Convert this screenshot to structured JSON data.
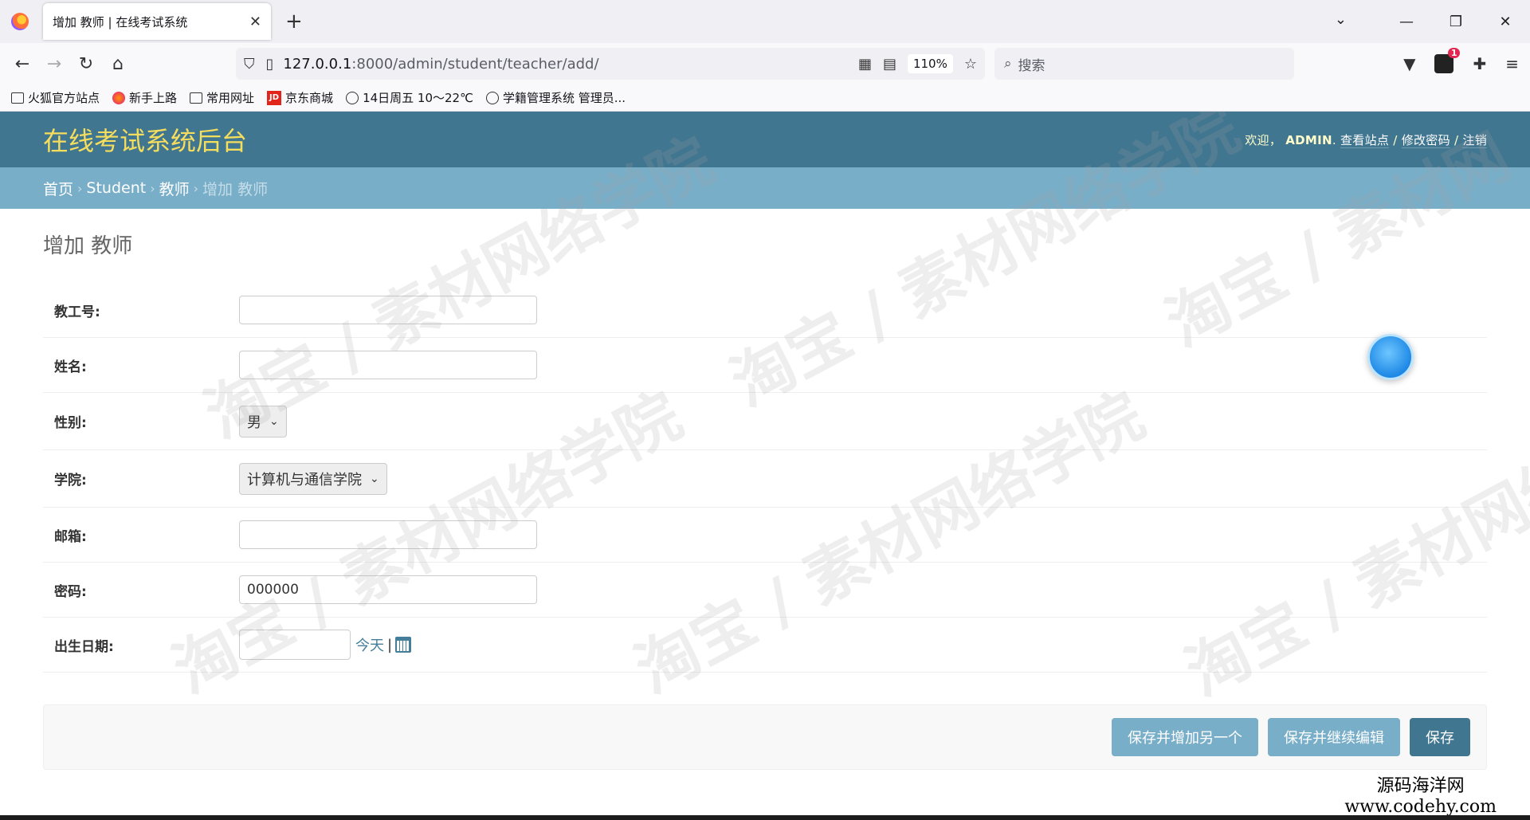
{
  "browser": {
    "tab_title": "增加 教师 | 在线考试系统",
    "url_host": "127.0.0.1",
    "url_path": ":8000/admin/student/teacher/add/",
    "zoom": "110%",
    "search_placeholder": "搜索",
    "extension_badge": "1",
    "bookmarks": [
      {
        "label": "火狐官方站点",
        "icon": "folder-icon"
      },
      {
        "label": "新手上路",
        "icon": "firefox-icon"
      },
      {
        "label": "常用网址",
        "icon": "folder-icon"
      },
      {
        "label": "京东商城",
        "icon": "jd-icon"
      },
      {
        "label": "14日周五  10～22℃",
        "icon": "globe-icon"
      },
      {
        "label": "学籍管理系统 管理员...",
        "icon": "globe-icon"
      }
    ]
  },
  "header": {
    "site_name": "在线考试系统后台",
    "welcome": "欢迎，",
    "username": "ADMIN",
    "view_site": "查看站点",
    "change_password": "修改密码",
    "logout": "注销"
  },
  "breadcrumbs": {
    "home": "首页",
    "app": "Student",
    "model": "教师",
    "current": "增加 教师"
  },
  "page": {
    "title": "增加 教师"
  },
  "form": {
    "fields": {
      "job_number": {
        "label": "教工号:",
        "value": ""
      },
      "name": {
        "label": "姓名:",
        "value": ""
      },
      "gender": {
        "label": "性别:",
        "value": "男"
      },
      "college": {
        "label": "学院:",
        "value": "计算机与通信学院"
      },
      "email": {
        "label": "邮箱:",
        "value": ""
      },
      "password": {
        "label": "密码:",
        "value": "000000"
      },
      "birth_date": {
        "label": "出生日期:",
        "value": "",
        "today": "今天",
        "divider": "|"
      }
    },
    "buttons": {
      "save_add_another": "保存并增加另一个",
      "save_continue": "保存并继续编辑",
      "save": "保存"
    }
  },
  "watermark": {
    "brand_cn": "源码海洋网",
    "brand_url": "www.codehy.com"
  }
}
